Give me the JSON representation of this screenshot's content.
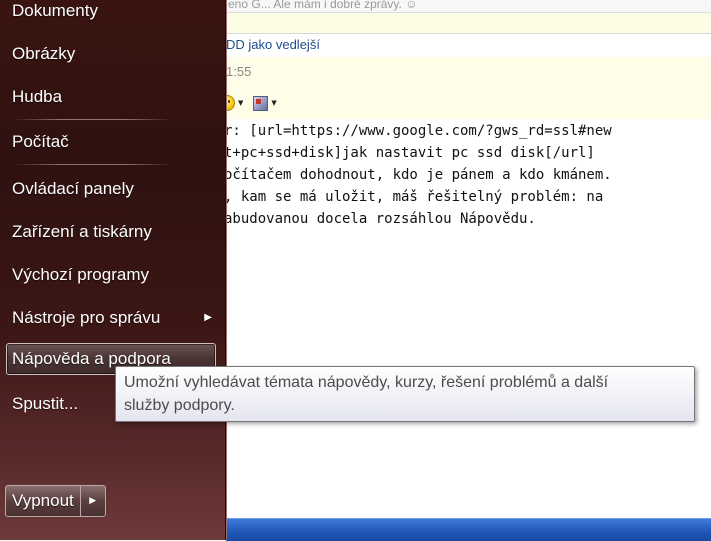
{
  "background_app": {
    "top_strip_text": "eno G... Ale mám i dobré zprávy. ☺",
    "subject_text": "DD jako vedlejší",
    "time_text": "1:55",
    "editor_lines": [
      "r: [url=https://www.google.com/?gws_rd=ssl#new",
      "t+pc+ssd+disk]jak nastavit pc ssd disk[/url]",
      "očítačem dohodnout, kdo je pánem a kdo kmánem.",
      ", kam se má uložit, máš řešitelný problém: na",
      "abudovanou docela rozsáhlou Nápovědu."
    ]
  },
  "start_menu": {
    "items": [
      {
        "label": "Dokumenty"
      },
      {
        "label": "Obrázky"
      },
      {
        "label": "Hudba"
      },
      {
        "label": "Počítač"
      },
      {
        "label": "Ovládací panely"
      },
      {
        "label": "Zařízení a tiskárny"
      },
      {
        "label": "Výchozí programy"
      },
      {
        "label": "Nástroje pro správu",
        "has_submenu": true
      },
      {
        "label": "Nápověda a podpora",
        "hovered": true
      },
      {
        "label": "Spustit..."
      }
    ],
    "shutdown_label": "Vypnout",
    "submenu_arrow": "▶",
    "shutdown_arrow": "▶"
  },
  "tooltip": {
    "line1": "Umožní vyhledávat témata nápovědy, kurzy, řešení problémů a další",
    "line2": "služby podpory."
  },
  "colors": {
    "menu_bg_top": "#3a1410",
    "menu_bg_bottom": "#6e3a3c",
    "subject_text": "#1f4c8f",
    "taskbar": "#1f56b8"
  }
}
